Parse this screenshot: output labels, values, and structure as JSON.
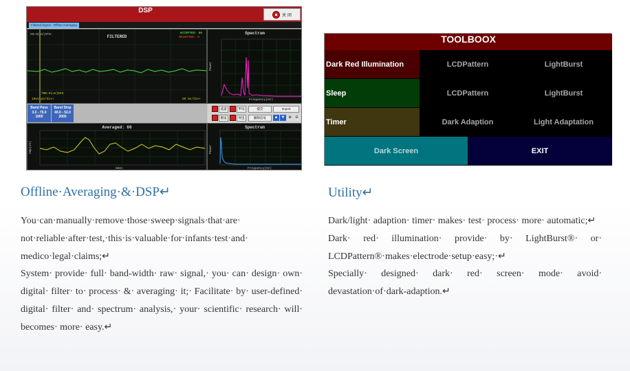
{
  "dsp": {
    "title": "DSP",
    "close_label": "关 闭",
    "tab_label": "Filtered Signal - Offline Averaging",
    "filtered": {
      "title": "FILTERED",
      "topleft": "X0:0(uV)ST0:",
      "accepted": "ACCEPTED: 66",
      "rejected": "REJECTED: 0",
      "bottomleft": "TB0:0(uV)EEX",
      "bottomleft2": "10uV  µV/div+",
      "bottomright": "50 ms/div+"
    },
    "spectrum": {
      "title": "Spectrum",
      "ylabel": "Power",
      "xlabel": "Frequency(Hz)"
    },
    "band_pass": {
      "label": "Band Pass",
      "range": "3.0 - 75.0",
      "value": "1000"
    },
    "band_stop": {
      "label": "Band Stop",
      "range": "40.0 - 52.0",
      "value": "2000"
    },
    "buttons": {
      "b1": "选道",
      "b2": "平均",
      "b3": "重设",
      "b4": "导出",
      "b5": "提交",
      "b6": "Import",
      "b7": "删除信号"
    },
    "averaged": {
      "title": "Averaged: 66",
      "ylabel": "Amp(uV)",
      "xlabel": "mSec"
    },
    "spectrum2": {
      "title": "Spectrum",
      "ylabel": "Power",
      "xlabel": "Frequency(Hz)"
    }
  },
  "toolbox": {
    "title": "TOOLBOOX",
    "rows": [
      [
        "Dark Red Illumination",
        "LCDPattern",
        "LightBurst"
      ],
      [
        "Sleep",
        "LCDPattern",
        "LightBurst"
      ],
      [
        "Timer",
        "Dark Adaption",
        "Light Adaptation"
      ]
    ],
    "dark_screen": "Dark Screen",
    "exit": "EXIT"
  },
  "left_section": {
    "heading": "Offline·Averaging·&·DSP↵",
    "paragraphs": [
      "You·can·manually·remove·those·sweep·signals·that·are· not·reliable·after·test,·this·is·valuable·for·infants·test·and· medico·legal·claims;↵",
      "System· provide· full· band-width· raw· signal,· you· can· design· own· digital· filter· to· process· &· averaging· it;· Facilitate· by· user-defined· digital· filter· and· spectrum· analysis,· your· scientific· research· will· becomes· more· easy.↵"
    ]
  },
  "right_section": {
    "heading": "Utility↵",
    "paragraphs": [
      "Dark/light· adaption· timer· makes· test· process· more· automatic;↵",
      "Dark· red· illumination· provide· by· LightBurst®· or· LCDPattern®·makes·electrode·setup·easy;·↵",
      "Specially· designed· dark· red· screen· mode· avoid· devastation·of·dark-adaption.↵"
    ]
  },
  "colors": {
    "heading": "#2d6fa3",
    "toolbox_title": "#6e0000",
    "dark_red": "#4a0000",
    "sleep_green": "#023d08",
    "timer_olive": "#403710",
    "dark_screen": "#00757f",
    "exit_navy": "#03003a"
  }
}
